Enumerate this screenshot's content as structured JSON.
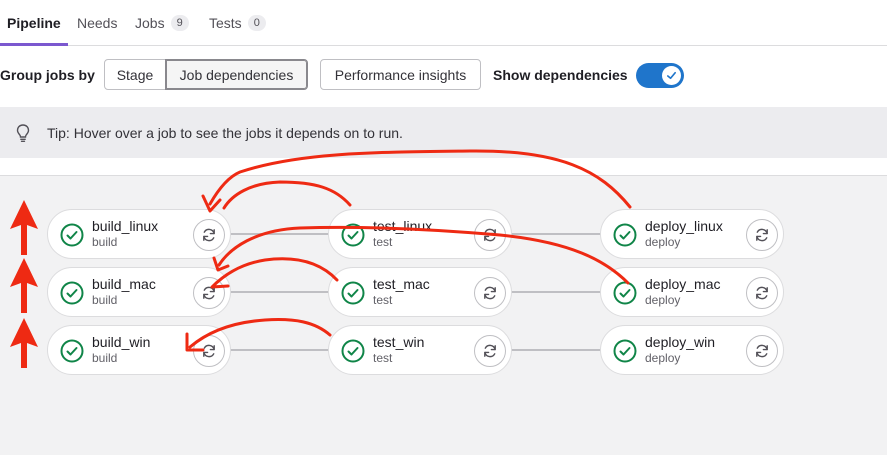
{
  "tabs": [
    {
      "label": "Pipeline",
      "active": true
    },
    {
      "label": "Needs"
    },
    {
      "label": "Jobs",
      "count": "9"
    },
    {
      "label": "Tests",
      "count": "0"
    }
  ],
  "toolbar": {
    "group_label": "Group jobs by",
    "stage_label": "Stage",
    "job_deps_label": "Job dependencies",
    "perf_label": "Performance insights",
    "show_deps_label": "Show dependencies",
    "show_deps_on": true
  },
  "tip": {
    "icon": "bulb-icon",
    "text": "Tip: Hover over a job to see the jobs it depends on to run."
  },
  "jobs": [
    {
      "name": "build_linux",
      "stage": "build",
      "status": "passed"
    },
    {
      "name": "test_linux",
      "stage": "test",
      "status": "passed"
    },
    {
      "name": "deploy_linux",
      "stage": "deploy",
      "status": "passed"
    },
    {
      "name": "build_mac",
      "stage": "build",
      "status": "passed"
    },
    {
      "name": "test_mac",
      "stage": "test",
      "status": "passed"
    },
    {
      "name": "deploy_mac",
      "stage": "deploy",
      "status": "passed"
    },
    {
      "name": "build_win",
      "stage": "build",
      "status": "passed"
    },
    {
      "name": "test_win",
      "stage": "test",
      "status": "passed"
    },
    {
      "name": "deploy_win",
      "stage": "deploy",
      "status": "passed"
    }
  ],
  "colors": {
    "accent": "#1f75cb",
    "success": "#108548",
    "annotation": "#ee2a13",
    "tab_active": "#7b58cf"
  }
}
